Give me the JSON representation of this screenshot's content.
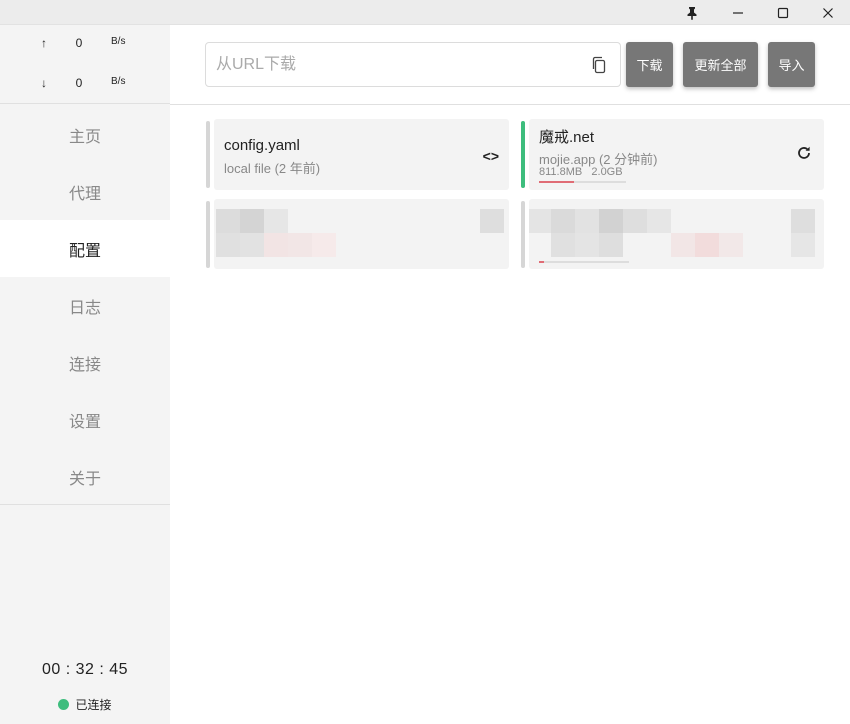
{
  "titlebar": {
    "pin_icon": "pin-icon",
    "minimize_icon": "minimize-icon",
    "maximize_icon": "maximize-icon",
    "close_icon": "close-icon"
  },
  "traffic": {
    "up_arrow": "↑",
    "up_value": "0",
    "up_unit": "B/s",
    "down_arrow": "↓",
    "down_value": "0",
    "down_unit": "B/s"
  },
  "nav": {
    "items": [
      {
        "label": "主页"
      },
      {
        "label": "代理"
      },
      {
        "label": "配置"
      },
      {
        "label": "日志"
      },
      {
        "label": "连接"
      },
      {
        "label": "设置"
      },
      {
        "label": "关于"
      }
    ],
    "active": "配置"
  },
  "footer": {
    "clock": "00 : 32 : 45",
    "status_label": "已连接",
    "status_color": "#3dbd7d"
  },
  "toolbar": {
    "url_placeholder": "从URL下载",
    "download_label": "下载",
    "update_all_label": "更新全部",
    "import_label": "导入"
  },
  "profiles": [
    {
      "name": "config.yaml",
      "subtitle": "local file (2 年前)",
      "action_icon": "code-icon",
      "selected": false
    },
    {
      "name": "魔戒.net",
      "subtitle": "mojie.app (2 分钟前)",
      "used": "811.8MB",
      "total": "2.0GB",
      "usage_fraction": 0.4,
      "action_icon": "refresh-icon",
      "selected": true,
      "accent": "#3dbd7d"
    }
  ],
  "colors": {
    "button_bg": "#777777",
    "usage_fill": "#e06c75",
    "selected_bar": "#3dbd7d"
  }
}
